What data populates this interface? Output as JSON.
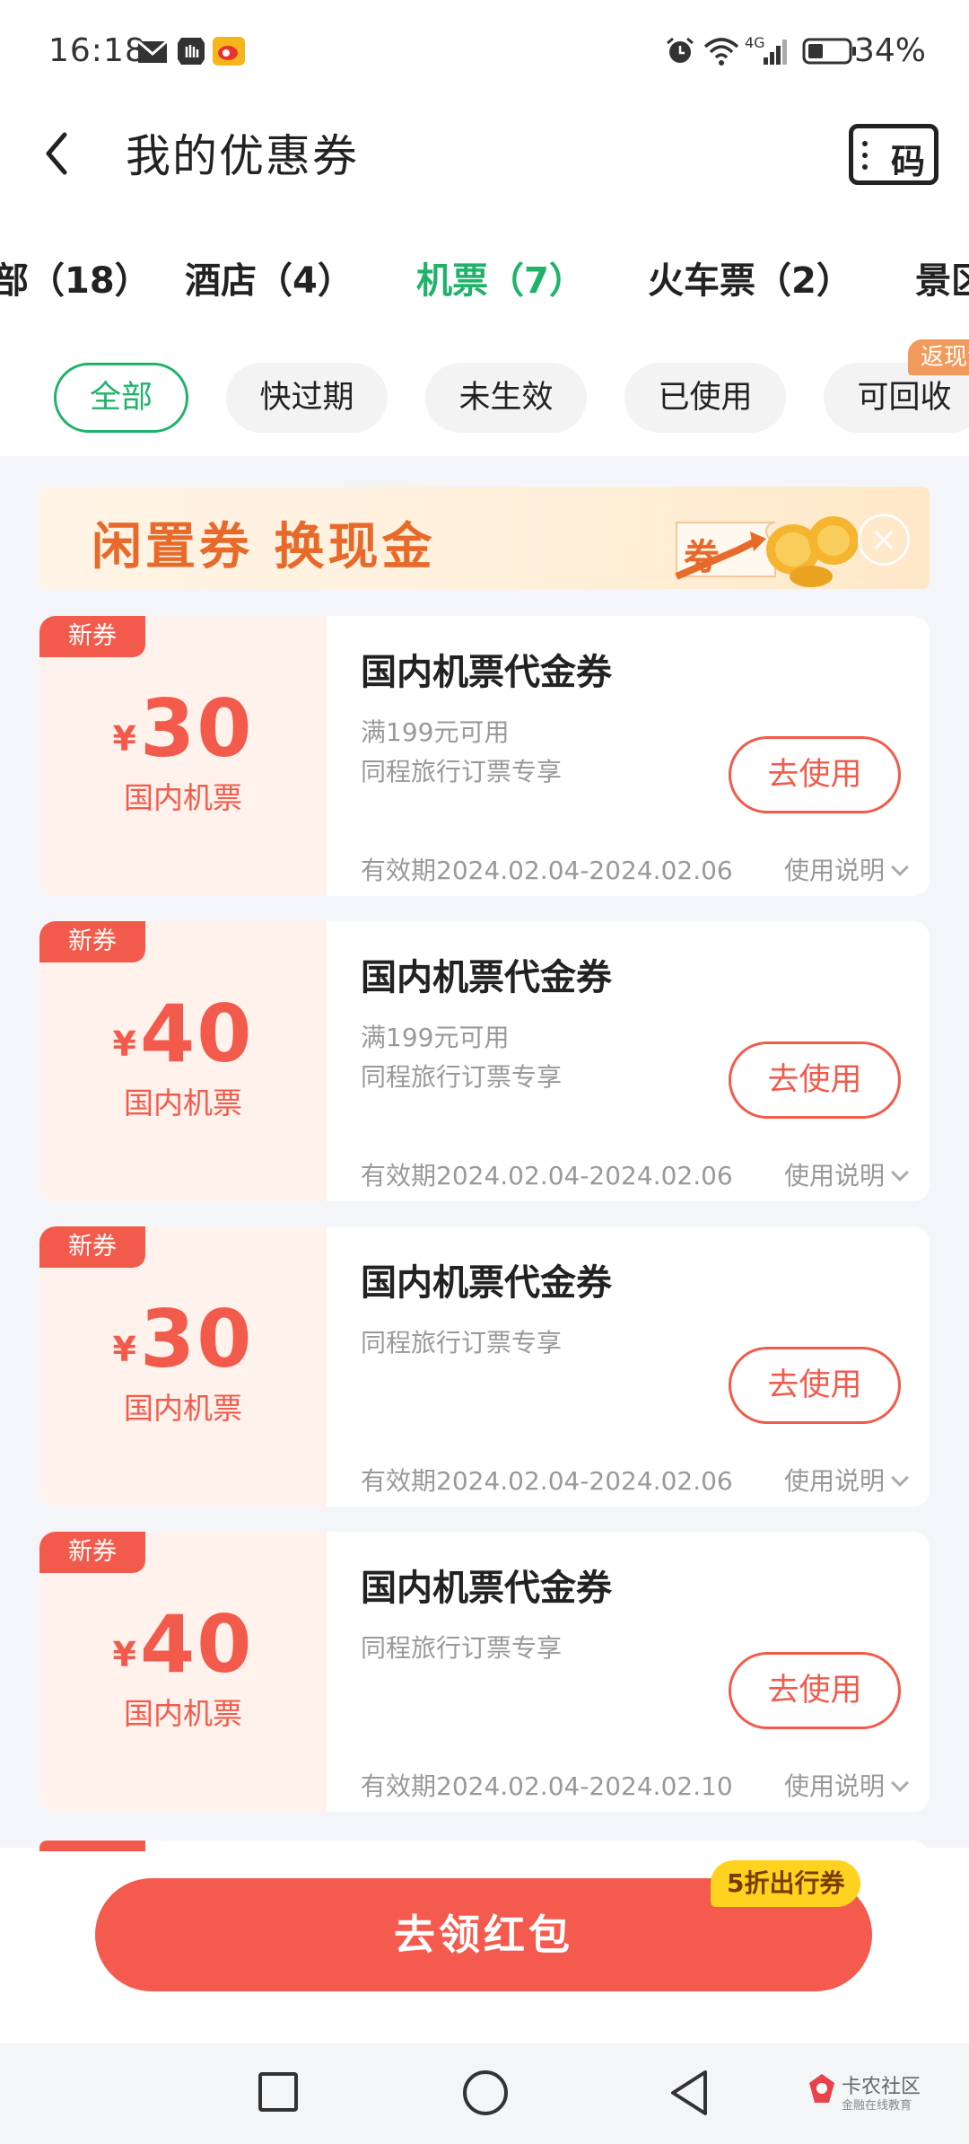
{
  "status_bar": {
    "time": "16:18",
    "network": "4G",
    "battery": "34%"
  },
  "header": {
    "title": "我的优惠券",
    "code_label": "码"
  },
  "category_tabs": [
    {
      "label": "部（18）"
    },
    {
      "label": "酒店（4）"
    },
    {
      "label": "机票（7）",
      "active": true
    },
    {
      "label": "火车票（2）"
    },
    {
      "label": "景区"
    }
  ],
  "filter_chips": [
    {
      "label": "全部",
      "active": true
    },
    {
      "label": "快过期"
    },
    {
      "label": "未生效"
    },
    {
      "label": "已使用"
    },
    {
      "label": "可回收"
    }
  ],
  "recycle_badge": "返现金",
  "banner": {
    "text": "闲置券 换现金",
    "art_label": "券"
  },
  "coupons": [
    {
      "badge": "新券",
      "currency": "¥",
      "amount": "30",
      "type": "国内机票",
      "title": "国内机票代金券",
      "condition": "满199元可用",
      "note": "同程旅行订票专享",
      "validity": "有效期2024.02.04-2024.02.06",
      "instructions": "使用说明",
      "button": "去使用"
    },
    {
      "badge": "新券",
      "currency": "¥",
      "amount": "40",
      "type": "国内机票",
      "title": "国内机票代金券",
      "condition": "满199元可用",
      "note": "同程旅行订票专享",
      "validity": "有效期2024.02.04-2024.02.06",
      "instructions": "使用说明",
      "button": "去使用"
    },
    {
      "badge": "新券",
      "currency": "¥",
      "amount": "30",
      "type": "国内机票",
      "title": "国内机票代金券",
      "condition": "",
      "note": "同程旅行订票专享",
      "validity": "有效期2024.02.04-2024.02.06",
      "instructions": "使用说明",
      "button": "去使用"
    },
    {
      "badge": "新券",
      "currency": "¥",
      "amount": "40",
      "type": "国内机票",
      "title": "国内机票代金券",
      "condition": "",
      "note": "同程旅行订票专享",
      "validity": "有效期2024.02.04-2024.02.10",
      "instructions": "使用说明",
      "button": "去使用"
    }
  ],
  "cta": {
    "label": "去领红包",
    "badge": "5折出行券"
  },
  "watermark": {
    "title": "卡农社区",
    "subtitle": "金融在线教育"
  },
  "colors": {
    "accent_green": "#1fb36a",
    "coupon_red": "#f25b4b",
    "cta_red": "#f55a4e",
    "badge_yellow": "#ffd21f"
  }
}
